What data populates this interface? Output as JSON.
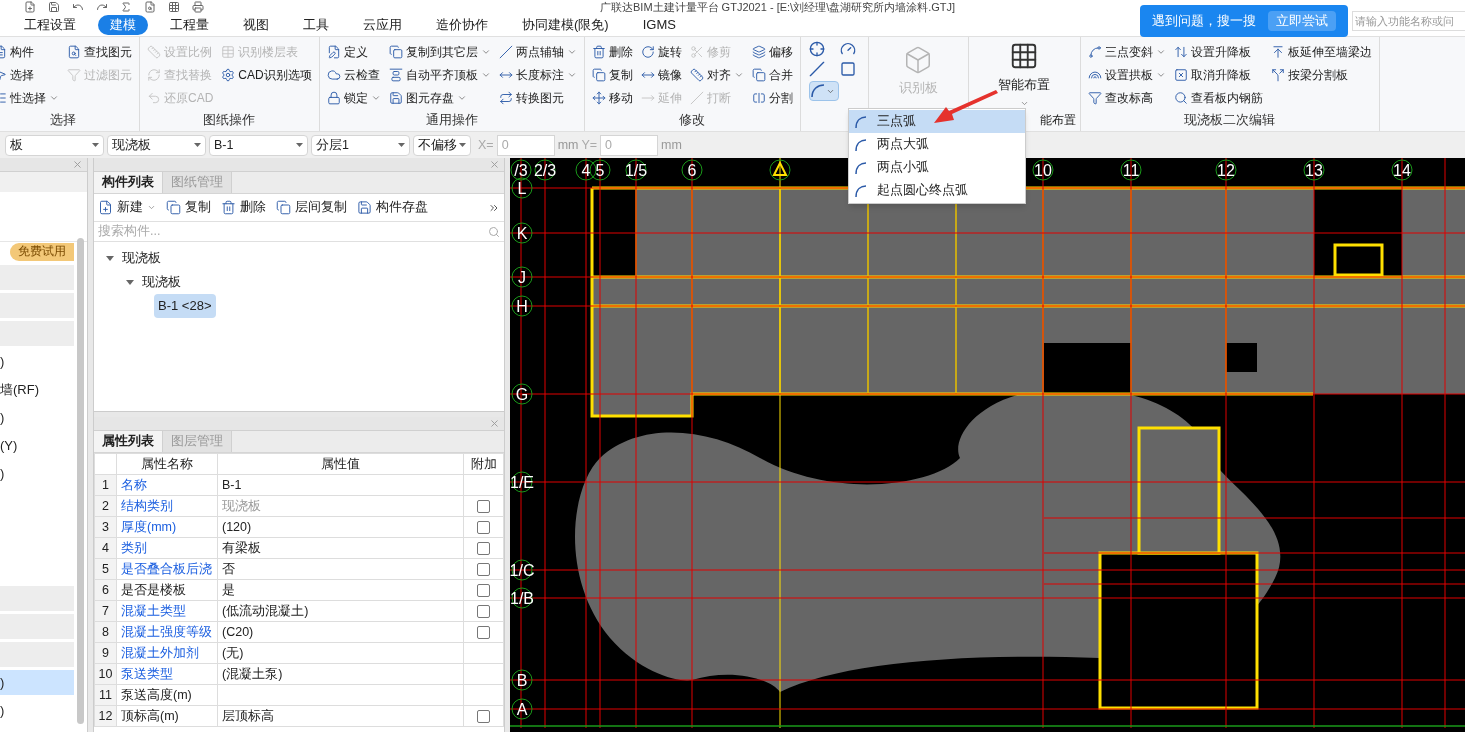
{
  "title": "广联达BIM土建计量平台 GTJ2021 - [E:\\刘经理\\盘湖研究所内墙涂料.GTJ]",
  "menu_tabs": [
    {
      "label": "工程设置",
      "selected": false
    },
    {
      "label": "建模",
      "selected": true
    },
    {
      "label": "工程量",
      "selected": false
    },
    {
      "label": "视图",
      "selected": false
    },
    {
      "label": "工具",
      "selected": false
    },
    {
      "label": "云应用",
      "selected": false
    },
    {
      "label": "造价协作",
      "selected": false
    },
    {
      "label": "协同建模(限免)",
      "selected": false
    },
    {
      "label": "IGMS",
      "selected": false
    }
  ],
  "help_popup": {
    "text": "遇到问题，搜一搜",
    "button": "立即尝试"
  },
  "search": {
    "placeholder": "请输入功能名称或问"
  },
  "ribbon": [
    {
      "label": "选择",
      "columns": [
        [
          {
            "label": "构件",
            "disabled": false,
            "dropdown": false
          },
          {
            "label": "选择",
            "disabled": false,
            "dropdown": false
          },
          {
            "label": "性选择",
            "disabled": false,
            "dropdown": true
          }
        ],
        [
          {
            "label": "查找图元",
            "disabled": false,
            "dropdown": false
          },
          {
            "label": "过滤图元",
            "disabled": true,
            "dropdown": false
          }
        ]
      ]
    },
    {
      "label": "图纸操作",
      "columns": [
        [
          {
            "label": "设置比例",
            "disabled": true,
            "dropdown": false
          },
          {
            "label": "查找替换",
            "disabled": true,
            "dropdown": false
          },
          {
            "label": "还原CAD",
            "disabled": true,
            "dropdown": false
          }
        ],
        [
          {
            "label": "识别楼层表",
            "disabled": true,
            "dropdown": false
          },
          {
            "label": "CAD识别选项",
            "disabled": false,
            "dropdown": false
          }
        ]
      ]
    },
    {
      "label": "通用操作",
      "columns": [
        [
          {
            "label": "定义",
            "disabled": false,
            "dropdown": false
          },
          {
            "label": "云检查",
            "disabled": false,
            "dropdown": false
          },
          {
            "label": "锁定",
            "disabled": false,
            "dropdown": true
          }
        ],
        [
          {
            "label": "复制到其它层",
            "disabled": false,
            "dropdown": true
          },
          {
            "label": "自动平齐顶板",
            "disabled": false,
            "dropdown": true
          },
          {
            "label": "图元存盘",
            "disabled": false,
            "dropdown": true
          }
        ],
        [
          {
            "label": "两点辅轴",
            "disabled": false,
            "dropdown": true
          },
          {
            "label": "长度标注",
            "disabled": false,
            "dropdown": true
          },
          {
            "label": "转换图元",
            "disabled": false,
            "dropdown": false
          }
        ]
      ]
    },
    {
      "label": "修改",
      "columns": [
        [
          {
            "label": "删除",
            "disabled": false,
            "dropdown": false
          },
          {
            "label": "复制",
            "disabled": false,
            "dropdown": false
          },
          {
            "label": "移动",
            "disabled": false,
            "dropdown": false
          }
        ],
        [
          {
            "label": "旋转",
            "disabled": false,
            "dropdown": false
          },
          {
            "label": "镜像",
            "disabled": false,
            "dropdown": false
          },
          {
            "label": "延伸",
            "disabled": true,
            "dropdown": false
          }
        ],
        [
          {
            "label": "修剪",
            "disabled": true,
            "dropdown": false
          },
          {
            "label": "对齐",
            "disabled": false,
            "dropdown": true
          },
          {
            "label": "打断",
            "disabled": true,
            "dropdown": false
          }
        ],
        [
          {
            "label": "偏移",
            "disabled": false,
            "dropdown": false
          },
          {
            "label": "合并",
            "disabled": false,
            "dropdown": false
          },
          {
            "label": "分割",
            "disabled": false,
            "dropdown": false
          }
        ]
      ]
    }
  ],
  "arc_dropdown": {
    "expanded": true,
    "items": [
      {
        "label": "三点弧",
        "selected": true
      },
      {
        "label": "两点大弧",
        "selected": false
      },
      {
        "label": "两点小弧",
        "selected": false
      },
      {
        "label": "起点圆心终点弧",
        "selected": false
      }
    ]
  },
  "recognize_board": {
    "label": "识别板",
    "disabled": true
  },
  "smart_layout": {
    "label": "智能布置",
    "group_label": "能布置"
  },
  "slab_edit": {
    "label": "现浇板二次编辑",
    "columns": [
      [
        {
          "label": "三点变斜",
          "disabled": false,
          "dropdown": true
        },
        {
          "label": "设置拱板",
          "disabled": false,
          "dropdown": true
        },
        {
          "label": "查改标高",
          "disabled": false,
          "dropdown": false
        }
      ],
      [
        {
          "label": "设置升降板",
          "disabled": false,
          "dropdown": false
        },
        {
          "label": "取消升降板",
          "disabled": false,
          "dropdown": false
        },
        {
          "label": "查看板内钢筋",
          "disabled": false,
          "dropdown": false
        }
      ],
      [
        {
          "label": "板延伸至墙梁边",
          "disabled": false,
          "dropdown": false
        },
        {
          "label": "按梁分割板",
          "disabled": false,
          "dropdown": false
        }
      ]
    ]
  },
  "filters": [
    {
      "value": "板"
    },
    {
      "value": "现浇板"
    },
    {
      "value": "B-1"
    },
    {
      "value": "分层1"
    },
    {
      "value": "不偏移"
    }
  ],
  "offset": {
    "x_label": "X=",
    "x_value": "0",
    "x_unit": "mm",
    "y_label": "Y=",
    "y_value": "0",
    "y_unit": "mm"
  },
  "nav_panel": {
    "rows": [
      {
        "kind": "badge",
        "label": "免费试用"
      },
      {
        "kind": "blank",
        "selected": false
      },
      {
        "kind": "blank",
        "selected": false
      },
      {
        "kind": "blank",
        "selected": false
      },
      {
        "kind": "text",
        "label": ")",
        "selected": false
      },
      {
        "kind": "text",
        "label": "墙(RF)",
        "selected": false
      },
      {
        "kind": "text",
        "label": ")",
        "selected": false
      },
      {
        "kind": "text",
        "label": "(Y)",
        "selected": false
      },
      {
        "kind": "text",
        "label": ")",
        "selected": false
      },
      {
        "kind": "gap"
      },
      {
        "kind": "blank",
        "selected": false
      },
      {
        "kind": "blank",
        "selected": false
      },
      {
        "kind": "blank",
        "selected": false
      },
      {
        "kind": "text",
        "label": ")",
        "selected": true
      },
      {
        "kind": "text",
        "label": ")",
        "selected": false
      }
    ]
  },
  "component_panel": {
    "tabs": [
      {
        "label": "构件列表",
        "selected": true
      },
      {
        "label": "图纸管理",
        "selected": false
      }
    ],
    "toolbar": [
      {
        "label": "新建",
        "dropdown": true
      },
      {
        "label": "复制",
        "dropdown": false
      },
      {
        "label": "删除",
        "dropdown": false
      },
      {
        "label": "层间复制",
        "dropdown": false
      },
      {
        "label": "构件存盘",
        "dropdown": false
      }
    ],
    "search_placeholder": "搜索构件...",
    "tree": [
      {
        "label": "现浇板",
        "expanded": true,
        "children": [
          {
            "label": "现浇板",
            "expanded": true,
            "children": [
              {
                "label": "B-1 <28>",
                "selected": true
              }
            ]
          }
        ]
      }
    ]
  },
  "property_panel": {
    "tabs": [
      {
        "label": "属性列表",
        "selected": true
      },
      {
        "label": "图层管理",
        "selected": false
      }
    ],
    "columns": [
      "属性名称",
      "属性值",
      "附加"
    ],
    "rows": [
      {
        "index": "1",
        "name": "名称",
        "value": "B-1",
        "linked": true,
        "muted": false
      },
      {
        "index": "2",
        "name": "结构类别",
        "value": "现浇板",
        "linked": true,
        "muted": true,
        "checkbox": {
          "checked": false
        }
      },
      {
        "index": "3",
        "name": "厚度(mm)",
        "value": "(120)",
        "linked": true,
        "muted": false,
        "checkbox": {
          "checked": false
        }
      },
      {
        "index": "4",
        "name": "类别",
        "value": "有梁板",
        "linked": true,
        "muted": false,
        "checkbox": {
          "checked": false
        }
      },
      {
        "index": "5",
        "name": "是否叠合板后浇",
        "value": "否",
        "linked": true,
        "muted": false,
        "checkbox": {
          "checked": false
        }
      },
      {
        "index": "6",
        "name": "是否是楼板",
        "value": "是",
        "linked": false,
        "muted": false,
        "checkbox": {
          "checked": false
        }
      },
      {
        "index": "7",
        "name": "混凝土类型",
        "value": "(低流动混凝土)",
        "linked": true,
        "muted": false,
        "checkbox": {
          "checked": false
        }
      },
      {
        "index": "8",
        "name": "混凝土强度等级",
        "value": "(C20)",
        "linked": true,
        "muted": false,
        "checkbox": {
          "checked": false
        }
      },
      {
        "index": "9",
        "name": "混凝土外加剂",
        "value": "(无)",
        "linked": true,
        "muted": false
      },
      {
        "index": "10",
        "name": "泵送类型",
        "value": "(混凝土泵)",
        "linked": true,
        "muted": false
      },
      {
        "index": "11",
        "name": "泵送高度(m)",
        "value": "",
        "linked": false
      },
      {
        "index": "12",
        "name": "顶标高(m)",
        "value": "层顶标高",
        "linked": false,
        "muted": false,
        "checkbox": {
          "checked": false
        }
      }
    ]
  },
  "canvas": {
    "top_axes": [
      {
        "kind": "label",
        "label": "/3"
      },
      {
        "kind": "label",
        "label": "2/3"
      },
      {
        "kind": "label",
        "label": "4"
      },
      {
        "kind": "label",
        "label": "5"
      },
      {
        "kind": "label",
        "label": "1/5"
      },
      {
        "kind": "label",
        "label": "6"
      },
      {
        "kind": "marker"
      },
      {
        "kind": "label",
        "label": "10"
      },
      {
        "kind": "label",
        "label": "11"
      },
      {
        "kind": "label",
        "label": "12"
      },
      {
        "kind": "label",
        "label": "13"
      },
      {
        "kind": "label",
        "label": "14"
      }
    ],
    "left_axes": [
      {
        "label": "L"
      },
      {
        "label": "K"
      },
      {
        "label": "J"
      },
      {
        "label": "H"
      },
      {
        "label": "G"
      },
      {
        "label": "1/E"
      },
      {
        "label": "1/C"
      },
      {
        "label": "1/B"
      },
      {
        "label": "B"
      },
      {
        "label": "A"
      }
    ]
  }
}
